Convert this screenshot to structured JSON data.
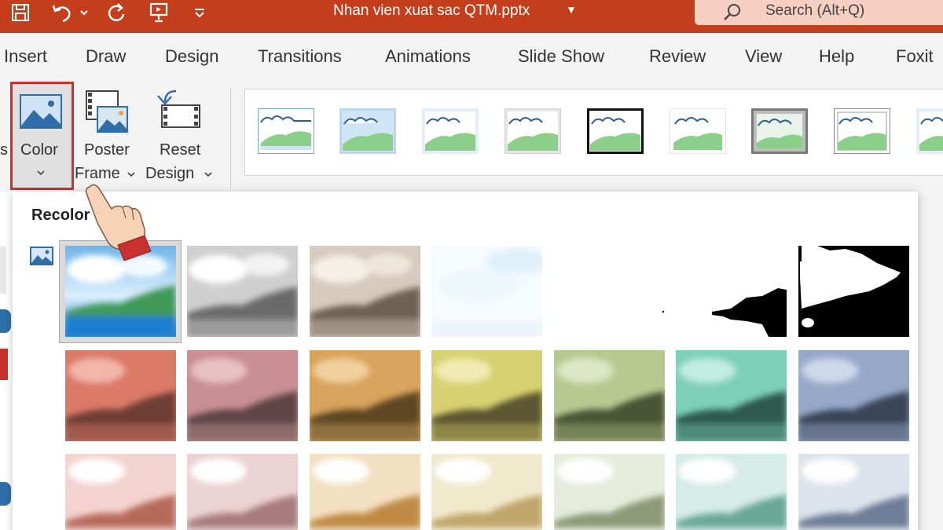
{
  "titlebar": {
    "document_title": "Nhan vien xuat sac QTM.pptx",
    "search_placeholder": "Search (Alt+Q)"
  },
  "tabs": [
    "Insert",
    "Draw",
    "Design",
    "Transitions",
    "Animations",
    "Slide Show",
    "Review",
    "View",
    "Help",
    "Foxit"
  ],
  "ribbon": {
    "color_label": "Color",
    "poster_label_1": "Poster",
    "poster_label_2": "Frame",
    "reset_label_1": "Reset",
    "reset_label_2": "Design",
    "truncated_left": "s"
  },
  "recolor": {
    "heading": "Recolor",
    "rows": [
      [
        "No Recolor",
        "Grayscale",
        "Sepia",
        "Washout",
        "Black and White: 25%",
        "Black and White: 50%",
        "Black and White: 75%"
      ],
      [
        "Red dark",
        "Rose dark",
        "Orange dark",
        "Gold dark",
        "Green dark",
        "Teal dark",
        "Blue dark"
      ],
      [
        "Red light",
        "Rose light",
        "Orange light",
        "Gold light",
        "Green light",
        "Teal light",
        "Blue light"
      ]
    ],
    "tints_row2": [
      "#dc7a68",
      "#c98f92",
      "#d8a35c",
      "#d8d070",
      "#b8c990",
      "#7dd0b8",
      "#95a8c8"
    ],
    "tints_row3": [
      "#f0c0b8",
      "#e6c2c2",
      "#f0d0a8",
      "#efe3b8",
      "#dfe6cc",
      "#c5e6dc",
      "#cdd6e4"
    ]
  },
  "colors": {
    "accent": "#c43e1c",
    "search_bg": "#f6cfc3",
    "highlight_border": "#c9312e"
  }
}
